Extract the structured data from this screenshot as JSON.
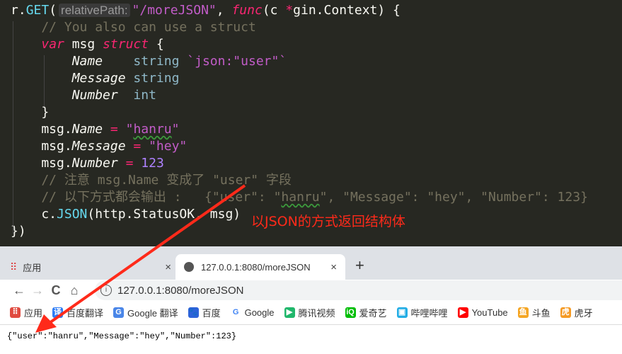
{
  "editor": {
    "lines": [
      [
        {
          "t": "r.",
          "c": ""
        },
        {
          "t": "GET",
          "c": "fn"
        },
        {
          "t": "(",
          "c": ""
        },
        {
          "t": "relativePath:",
          "c": "hint"
        },
        {
          "t": "\"/moreJSON\"",
          "c": "str"
        },
        {
          "t": ", ",
          "c": ""
        },
        {
          "t": "func",
          "c": "kw"
        },
        {
          "t": "(c ",
          "c": ""
        },
        {
          "t": "*",
          "c": "op"
        },
        {
          "t": "gin.Context) {",
          "c": ""
        }
      ],
      [
        {
          "t": "    // You also can use a struct",
          "c": "cm"
        }
      ],
      [
        {
          "t": "    ",
          "c": ""
        },
        {
          "t": "var",
          "c": "kw"
        },
        {
          "t": " msg ",
          "c": ""
        },
        {
          "t": "struct",
          "c": "kw"
        },
        {
          "t": " {",
          "c": ""
        }
      ],
      [
        {
          "t": "        ",
          "c": ""
        },
        {
          "t": "Name",
          "c": "fld"
        },
        {
          "t": "    ",
          "c": ""
        },
        {
          "t": "string",
          "c": "ty"
        },
        {
          "t": " `json:\"user\"`",
          "c": "str"
        }
      ],
      [
        {
          "t": "        ",
          "c": ""
        },
        {
          "t": "Message",
          "c": "fld"
        },
        {
          "t": " ",
          "c": ""
        },
        {
          "t": "string",
          "c": "ty"
        }
      ],
      [
        {
          "t": "        ",
          "c": ""
        },
        {
          "t": "Number",
          "c": "fld"
        },
        {
          "t": "  ",
          "c": ""
        },
        {
          "t": "int",
          "c": "ty"
        }
      ],
      [
        {
          "t": "    }",
          "c": ""
        }
      ],
      [
        {
          "t": "    msg.",
          "c": ""
        },
        {
          "t": "Name",
          "c": "fld"
        },
        {
          "t": " ",
          "c": ""
        },
        {
          "t": "=",
          "c": "op"
        },
        {
          "t": " \"",
          "c": "str"
        },
        {
          "t": "hanru",
          "c": "str squig"
        },
        {
          "t": "\"",
          "c": "str"
        }
      ],
      [
        {
          "t": "    msg.",
          "c": ""
        },
        {
          "t": "Message",
          "c": "fld"
        },
        {
          "t": " ",
          "c": ""
        },
        {
          "t": "=",
          "c": "op"
        },
        {
          "t": " \"hey\"",
          "c": "str"
        }
      ],
      [
        {
          "t": "    msg.",
          "c": ""
        },
        {
          "t": "Number",
          "c": "fld"
        },
        {
          "t": " ",
          "c": ""
        },
        {
          "t": "=",
          "c": "op"
        },
        {
          "t": " ",
          "c": ""
        },
        {
          "t": "123",
          "c": "num"
        }
      ],
      [
        {
          "t": "    // 注意 msg.Name 变成了 \"user\" 字段",
          "c": "cm"
        }
      ],
      [
        {
          "t": "    // 以下方式都会输出 :   {\"user\": \"",
          "c": "cm"
        },
        {
          "t": "hanru",
          "c": "cm squig"
        },
        {
          "t": "\", \"Message\": \"hey\", \"Number\": 123}",
          "c": "cm"
        }
      ],
      [
        {
          "t": "    c.",
          "c": ""
        },
        {
          "t": "JSON",
          "c": "fn"
        },
        {
          "t": "(http.StatusOK, msg)",
          "c": ""
        }
      ],
      [
        {
          "t": "})",
          "c": ""
        }
      ]
    ]
  },
  "annotation": "以JSON的方式返回结构体",
  "annotation_color": "#ff2a1a",
  "browser": {
    "tabs": [
      {
        "label": "应用",
        "icon": "apps-grid-icon"
      },
      {
        "label": "127.0.0.1:8080/moreJSON",
        "icon": "globe-icon"
      }
    ],
    "close_glyph": "×",
    "new_tab_glyph": "+",
    "nav": {
      "back": "←",
      "forward": "→",
      "reload": "C",
      "home": "⌂"
    },
    "address": "127.0.0.1:8080/moreJSON",
    "bookmarks": [
      {
        "label": "应用",
        "color": "#e04a3f",
        "glyph": "⠿"
      },
      {
        "label": "百度翻译",
        "color": "#2d7cf6",
        "glyph": "译"
      },
      {
        "label": "Google 翻译",
        "color": "#4a86e8",
        "glyph": "G"
      },
      {
        "label": "百度",
        "color": "#2d63d9",
        "glyph": "🐾"
      },
      {
        "label": "Google",
        "color": "#ffffff",
        "glyph": "G"
      },
      {
        "label": "腾讯视频",
        "color": "#20b76b",
        "glyph": "▶"
      },
      {
        "label": "爱奇艺",
        "color": "#00be06",
        "glyph": "iQ"
      },
      {
        "label": "哔哩哔哩",
        "color": "#23ade5",
        "glyph": "▣"
      },
      {
        "label": "YouTube",
        "color": "#ff0000",
        "glyph": "▶"
      },
      {
        "label": "斗鱼",
        "color": "#f5a623",
        "glyph": "鱼"
      },
      {
        "label": "虎牙",
        "color": "#f59a23",
        "glyph": "虎"
      }
    ],
    "content": "{\"user\":\"hanru\",\"Message\":\"hey\",\"Number\":123}"
  }
}
